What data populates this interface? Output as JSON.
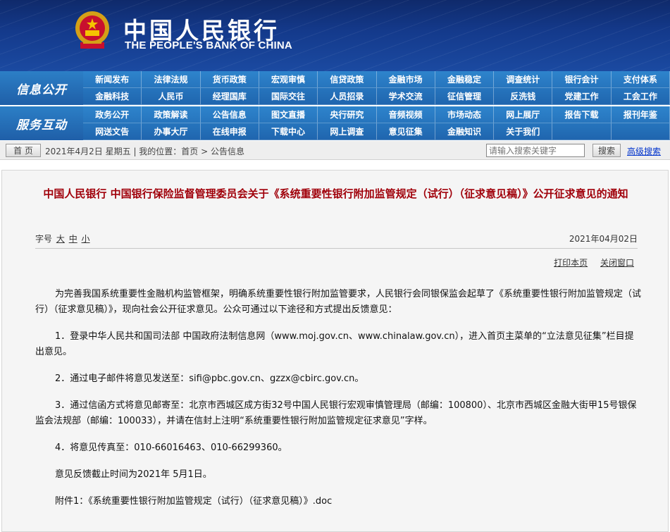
{
  "header": {
    "title_cn": "中国人民银行",
    "title_en": "THE PEOPLE'S BANK OF CHINA"
  },
  "nav": {
    "group1_label": "信息公开",
    "group1_items": [
      "新闻发布",
      "法律法规",
      "货币政策",
      "宏观审慎",
      "信贷政策",
      "金融市场",
      "金融稳定",
      "调查统计",
      "银行会计",
      "支付体系",
      "金融科技",
      "人民币",
      "经理国库",
      "国际交往",
      "人员招录",
      "学术交流",
      "征信管理",
      "反洗钱",
      "党建工作",
      "工会工作"
    ],
    "group2_label": "服务互动",
    "group2_items": [
      "政务公开",
      "政策解读",
      "公告信息",
      "图文直播",
      "央行研究",
      "音频视频",
      "市场动态",
      "网上展厅",
      "报告下载",
      "报刊年鉴",
      "网送文告",
      "办事大厅",
      "在线申报",
      "下载中心",
      "网上调查",
      "意见征集",
      "金融知识",
      "关于我们",
      "",
      ""
    ]
  },
  "crumb": {
    "home_label": "首 页",
    "text": "2021年4月2日 星期五 | 我的位置：首页 > 公告信息",
    "search_placeholder": "请输入搜索关键字",
    "search_button": "搜索",
    "advanced_search": "高级搜索"
  },
  "article": {
    "title": "中国人民银行 中国银行保险监督管理委员会关于《系统重要性银行附加监管规定（试行）（征求意见稿）》公开征求意见的通知",
    "font_label": "字号",
    "font_large": "大",
    "font_medium": "中",
    "font_small": "小",
    "date": "2021年04月02日",
    "print": "打印本页",
    "close": "关闭窗口",
    "paragraphs": [
      "为完善我国系统重要性金融机构监管框架，明确系统重要性银行附加监管要求，人民银行会同银保监会起草了《系统重要性银行附加监管规定（试行）（征求意见稿）》，现向社会公开征求意见。公众可通过以下途径和方式提出反馈意见：",
      "1．登录中华人民共和国司法部 中国政府法制信息网（www.moj.gov.cn、www.chinalaw.gov.cn），进入首页主菜单的“立法意见征集”栏目提出意见。",
      "2．通过电子邮件将意见发送至：sifi@pbc.gov.cn、gzzx@cbirc.gov.cn。",
      "3．通过信函方式将意见邮寄至：北京市西城区成方街32号中国人民银行宏观审慎管理局（邮编：100800）、北京市西城区金融大街甲15号银保监会法规部（邮编：100033），并请在信封上注明“系统重要性银行附加监管规定征求意见”字样。",
      "4．将意见传真至：010-66016463、010-66299360。",
      "意见反馈截止时间为2021年 5月1日。",
      "附件1：《系统重要性银行附加监管规定（试行）（征求意见稿）》.doc"
    ]
  }
}
